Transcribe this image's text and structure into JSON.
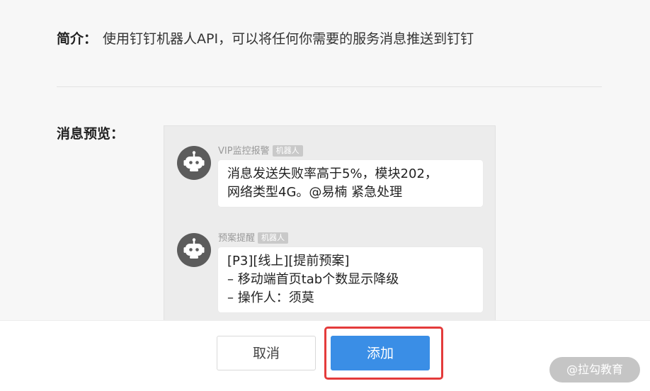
{
  "intro": {
    "label": "简介：",
    "text": "使用钉钉机器人API，可以将任何你需要的服务消息推送到钉钉"
  },
  "preview": {
    "label": "消息预览：",
    "messages": [
      {
        "sender": "VIP监控报警",
        "tag": "机器人",
        "body": "消息发送失败率高于5%，模块202，\n网络类型4G。@易楠 紧急处理",
        "avatar_icon": "robot-icon"
      },
      {
        "sender": "预案提醒",
        "tag": "机器人",
        "body": "[P3][线上][提前预案]\n– 移动端首页tab个数显示降级\n– 操作人：须莫",
        "avatar_icon": "robot-icon"
      }
    ]
  },
  "footer": {
    "cancel_label": "取消",
    "add_label": "添加"
  },
  "watermark": "@拉勾教育",
  "colors": {
    "primary": "#3a8ee6",
    "highlight": "#e43b3b",
    "avatar_bg": "#5c5c5c",
    "panel_bg": "#ececec"
  }
}
